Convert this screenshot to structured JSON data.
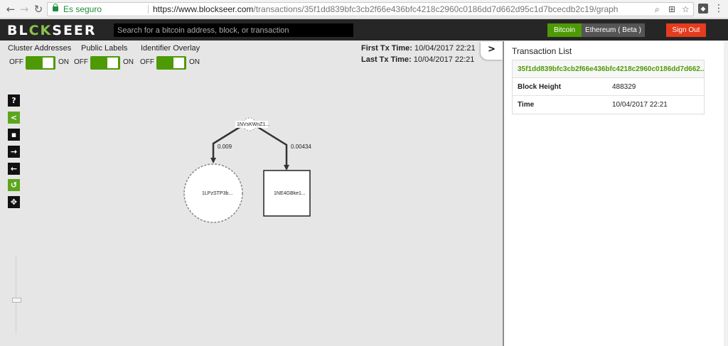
{
  "browser": {
    "secure_label": "Es seguro",
    "url_host": "https://www.blockseer.com",
    "url_path": "/transactions/35f1dd839bfc3cb2f66e436bfc4218c2960c0186dd7d662d95c1d7bcecdb2c19/graph"
  },
  "app": {
    "logo_left": "BL",
    "logo_accent": "CK",
    "logo_right": "SEER",
    "search_placeholder": "Search for a bitcoin address, block, or transaction",
    "btn_bitcoin": "Bitcoin",
    "btn_ethereum": "Ethereum ( Beta )",
    "btn_signout": "Sign Out"
  },
  "toggles": [
    {
      "label": "Cluster Addresses",
      "off": "OFF",
      "on": "ON"
    },
    {
      "label": "Public Labels",
      "off": "OFF",
      "on": "ON"
    },
    {
      "label": "Identifier Overlay",
      "off": "OFF",
      "on": "ON"
    }
  ],
  "times": {
    "first_label": "First Tx Time:",
    "first_value": "10/04/2017 22:21",
    "last_label": "Last Tx Time:",
    "last_value": "10/04/2017 22:21"
  },
  "tools": {
    "help": "?",
    "share": "<",
    "save": "▪",
    "forward": "→",
    "back": "←",
    "undo": "↺",
    "fit": "✥"
  },
  "graph": {
    "source_label": "1NVsKWnZ1...",
    "target1_label": "1LPzSTP3b...",
    "target2_label": "1NE4GBke1...",
    "edge1_label": "0.009",
    "edge2_label": "0.00434"
  },
  "panel": {
    "collapse": ">",
    "title": "Transaction List",
    "tx_hash": "35f1dd839bfc3cb2f66e436bfc4218c2960c0186dd7d662...",
    "rows": [
      {
        "key": "Block Height",
        "value": "488329"
      },
      {
        "key": "Time",
        "value": "10/04/2017 22:21"
      }
    ]
  },
  "colors": {
    "accent_green": "#4e9a06",
    "signout_red": "#e53b1e",
    "appbar": "#262626"
  }
}
